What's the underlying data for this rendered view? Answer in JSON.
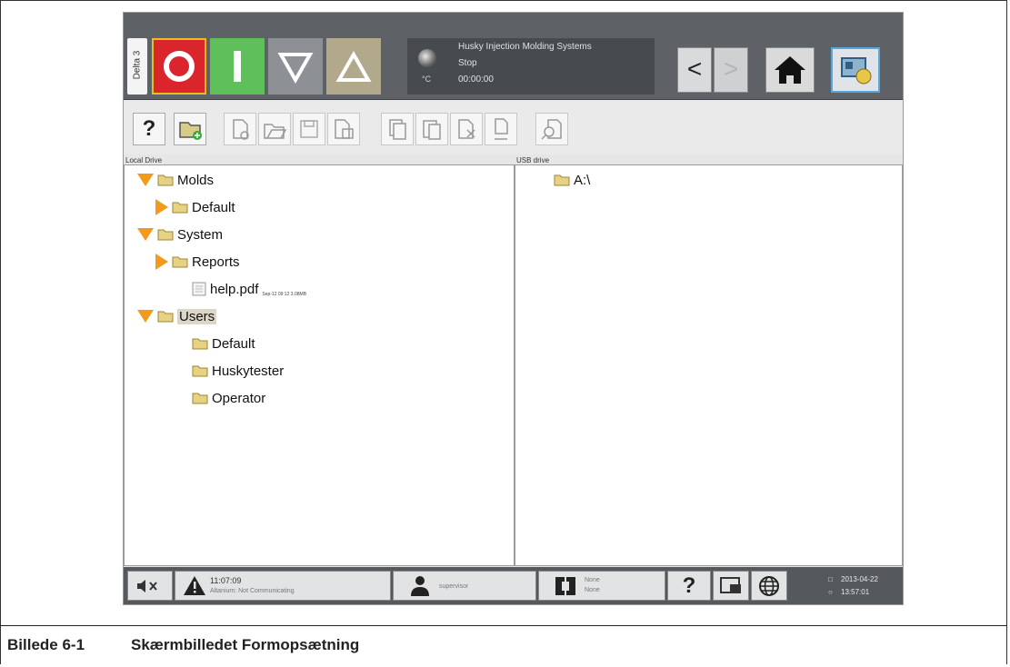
{
  "topbar": {
    "delta_label": "Delta 3",
    "status_temp_unit": "°C",
    "status_lines": [
      "Husky Injection Molding Systems",
      "Stop",
      "00:00:00"
    ],
    "nav_back": "<",
    "nav_forward": ">",
    "colors": {
      "stop": "#d9252b",
      "start": "#5fbf5a",
      "down": "#8d9196",
      "up": "#b2a98c"
    }
  },
  "toolbar": {
    "help_label": "?"
  },
  "left_pane": {
    "header": "Local Drive",
    "tree": [
      {
        "label": "Molds",
        "expander": "expanded",
        "icon": "folder"
      },
      {
        "label": "Default",
        "expander": "collapsed",
        "icon": "folder"
      },
      {
        "label": "System",
        "expander": "expanded",
        "icon": "folder"
      },
      {
        "label": "Reports",
        "expander": "collapsed",
        "icon": "folder"
      },
      {
        "label": "help.pdf",
        "expander": "none",
        "icon": "document",
        "meta": "Sep-12 09:12  3.08MB"
      },
      {
        "label": "Users",
        "expander": "expanded",
        "icon": "folder",
        "selected": true
      },
      {
        "label": "Default",
        "expander": "none",
        "icon": "folder"
      },
      {
        "label": "Huskytester",
        "expander": "none",
        "icon": "folder"
      },
      {
        "label": "Operator",
        "expander": "none",
        "icon": "folder"
      }
    ]
  },
  "right_pane": {
    "header": "USB drive",
    "tree": [
      {
        "label": "A:\\",
        "icon": "folder"
      }
    ]
  },
  "bottombar": {
    "alarm_time": "11:07:09",
    "alarm_text": "Altanium: Not Communicating",
    "user": "supervisor",
    "mold_line1": "None",
    "mold_line2": "None",
    "help_label": "?",
    "date": "2013-04-22",
    "time": "13:57:01"
  },
  "caption": {
    "number": "Billede 6-1",
    "title": "Skærmbilledet Formopsætning"
  }
}
